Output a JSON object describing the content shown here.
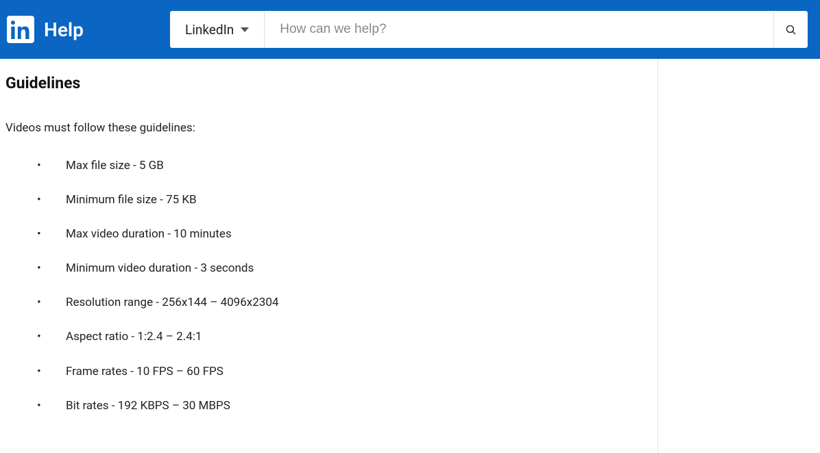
{
  "header": {
    "help_label": "Help",
    "dropdown_selected": "LinkedIn",
    "search_placeholder": "How can we help?"
  },
  "page": {
    "title": "Guidelines",
    "intro": "Videos must follow these guidelines:",
    "items": [
      "Max file size - 5 GB",
      "Minimum file size - 75 KB",
      "Max video duration - 10 minutes",
      "Minimum video duration - 3 seconds",
      "Resolution range - 256x144 – 4096x2304",
      "Aspect ratio - 1:2.4 – 2.4:1",
      "Frame rates - 10 FPS – 60 FPS",
      "Bit rates - 192 KBPS – 30 MBPS"
    ]
  }
}
